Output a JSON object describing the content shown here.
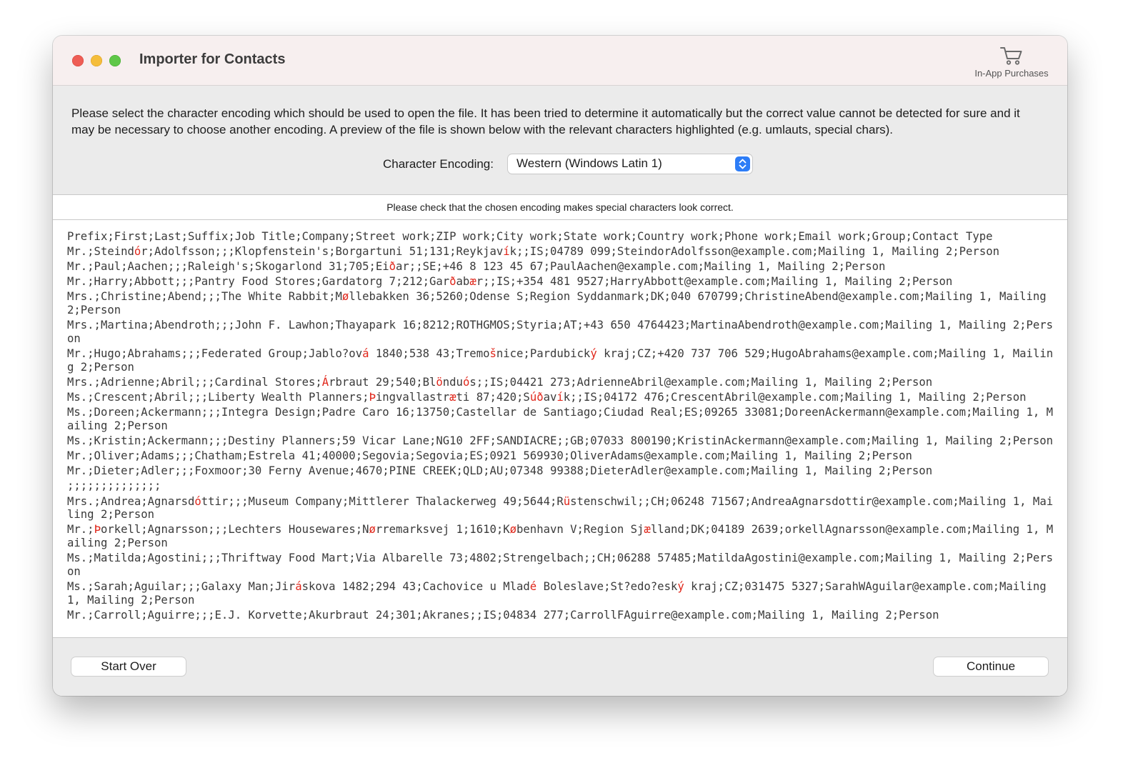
{
  "window": {
    "title": "Importer for Contacts",
    "iap_icon": "cart-icon",
    "iap_label": "In-App Purchases"
  },
  "header": {
    "instructions": "Please select the character encoding which should be used to open the file. It has been tried to determine it automatically but the correct value cannot be detected for sure and it may be necessary to choose another encoding. A preview of the file is shown below with the relevant characters highlighted (e.g. umlauts, special chars).",
    "encoding_label": "Character Encoding:",
    "encoding_value": "Western (Windows Latin 1)"
  },
  "notice": "Please check that the chosen encoding makes special characters look correct.",
  "highlight_color": "#e0261a",
  "preview_lines": [
    "Prefix;First;Last;Suffix;Job Title;Company;Street work;ZIP work;City work;State work;Country work;Phone work;Email work;Group;Contact Type",
    "Mr.;Steind[ó]r;Adolfsson;;;Klopfenstein's;Borgartuni 51;131;Reykjav[í]k;;IS;04789 099;SteindorAdolfsson@example.com;Mailing 1, Mailing 2;Person",
    "Mr.;Paul;Aachen;;;Raleigh's;Skogarlond 31;705;Ei[ð]ar;;SE;+46 8 123 45 67;PaulAachen@example.com;Mailing 1, Mailing 2;Person",
    "Mr.;Harry;Abbott;;;Pantry Food Stores;Gardatorg 7;212;Gar[ð]ab[æ]r;;IS;+354 481 9527;HarryAbbott@example.com;Mailing 1, Mailing 2;Person",
    "Mrs.;Christine;Abend;;;The White Rabbit;M[ø]llebakken 36;5260;Odense S;Region Syddanmark;DK;040 670799;ChristineAbend@example.com;Mailing 1, Mailing 2;Person",
    "Mrs.;Martina;Abendroth;;;John F. Lawhon;Thayapark 16;8212;ROTHGMOS;Styria;AT;+43 650 4764423;MartinaAbendroth@example.com;Mailing 1, Mailing 2;Person",
    "Mr.;Hugo;Abrahams;;;Federated Group;Jablo?ov[á] 1840;538 43;Tremo[š]nice;Pardubick[ý] kraj;CZ;+420 737 706 529;HugoAbrahams@example.com;Mailing 1, Mailing 2;Person",
    "Mrs.;Adrienne;Abril;;;Cardinal Stores;[Á]rbraut 29;540;Bl[ö]ndu[ó]s;;IS;04421 273;AdrienneAbril@example.com;Mailing 1, Mailing 2;Person",
    "Ms.;Crescent;Abril;;;Liberty Wealth Planners;[Þ]ingvallastr[æ]ti 87;420;S[ú][ð]av[í]k;;IS;04172 476;CrescentAbril@example.com;Mailing 1, Mailing 2;Person",
    "Ms.;Doreen;Ackermann;;;Integra Design;Padre Caro 16;13750;Castellar de Santiago;Ciudad Real;ES;09265 33081;DoreenAckermann@example.com;Mailing 1, Mailing 2;Person",
    "Ms.;Kristin;Ackermann;;;Destiny Planners;59 Vicar Lane;NG10 2FF;SANDIACRE;;GB;07033 800190;KristinAckermann@example.com;Mailing 1, Mailing 2;Person",
    "Mr.;Oliver;Adams;;;Chatham;Estrela 41;40000;Segovia;Segovia;ES;0921 569930;OliverAdams@example.com;Mailing 1, Mailing 2;Person",
    "Mr.;Dieter;Adler;;;Foxmoor;30 Ferny Avenue;4670;PINE CREEK;QLD;AU;07348 99388;DieterAdler@example.com;Mailing 1, Mailing 2;Person",
    ";;;;;;;;;;;;;;",
    "Mrs.;Andrea;Agnarsd[ó]ttir;;;Museum Company;Mittlerer Thalackerweg 49;5644;R[ü]stenschwil;;CH;06248 71567;AndreaAgnarsdottir@example.com;Mailing 1, Mailing 2;Person",
    "Mr.;[Þ]orkell;Agnarsson;;;Lechters Housewares;N[ø]rremarksvej 1;1610;K[ø]benhavn V;Region Sj[æ]lland;DK;04189 2639;orkellAgnarsson@example.com;Mailing 1, Mailing 2;Person",
    "Ms.;Matilda;Agostini;;;Thriftway Food Mart;Via Albarelle 73;4802;Strengelbach;;CH;06288 57485;MatildaAgostini@example.com;Mailing 1, Mailing 2;Person",
    "Ms.;Sarah;Aguilar;;;Galaxy Man;Jir[á]skova 1482;294 43;Cachovice u Mlad[é] Boleslave;St?edo?esk[ý] kraj;CZ;031475 5327;SarahWAguilar@example.com;Mailing 1, Mailing 2;Person",
    "Mr.;Carroll;Aguirre;;;E.J. Korvette;Akurbraut 24;301;Akranes;;IS;04834 277;CarrollFAguirre@example.com;Mailing 1, Mailing 2;Person"
  ],
  "footer": {
    "start_over_label": "Start Over",
    "continue_label": "Continue"
  }
}
